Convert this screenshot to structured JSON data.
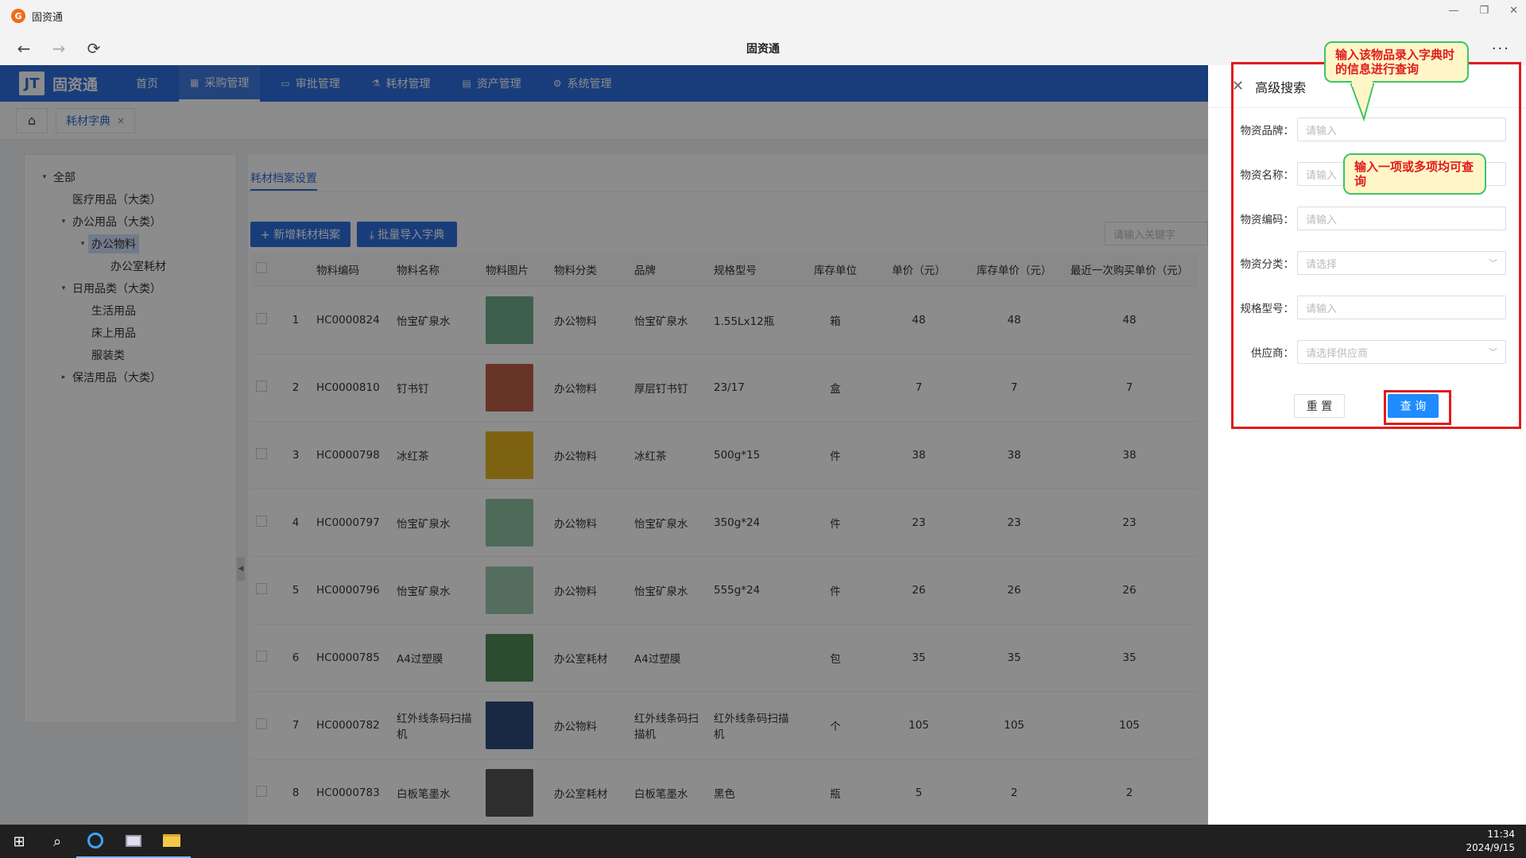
{
  "window": {
    "title": "固资通",
    "app_icon_letter": "G",
    "page_title": "固资通",
    "controls": [
      "—",
      "❐",
      "✕"
    ]
  },
  "browser": {
    "back": "←",
    "forward": "→",
    "refresh": "⟳",
    "more": "···"
  },
  "brand": {
    "logo_mark": "JT",
    "name": "固资通"
  },
  "topnav": [
    {
      "label": "首页",
      "icon": ""
    },
    {
      "label": "采购管理",
      "icon": "grid-icon",
      "active": true
    },
    {
      "label": "审批管理",
      "icon": "monitor-icon"
    },
    {
      "label": "耗材管理",
      "icon": "flask-icon"
    },
    {
      "label": "资产管理",
      "icon": "calendar-icon"
    },
    {
      "label": "系统管理",
      "icon": "gear-icon"
    }
  ],
  "tabs": {
    "home_icon": "⌂",
    "open_tab": "耗材字典",
    "close": "×"
  },
  "tree": [
    {
      "label": "全部",
      "level": 0,
      "toggle": "▾"
    },
    {
      "label": "医疗用品（大类）",
      "level": 1,
      "toggle": ""
    },
    {
      "label": "办公用品（大类）",
      "level": 1,
      "toggle": "▾"
    },
    {
      "label": "办公物料",
      "level": 2,
      "toggle": "▾",
      "selected": true
    },
    {
      "label": "办公室耗材",
      "level": 3,
      "toggle": ""
    },
    {
      "label": "日用品类（大类）",
      "level": 1,
      "toggle": "▾"
    },
    {
      "label": "生活用品",
      "level": 2,
      "toggle": ""
    },
    {
      "label": "床上用品",
      "level": 2,
      "toggle": ""
    },
    {
      "label": "服装类",
      "level": 2,
      "toggle": ""
    },
    {
      "label": "保洁用品（大类）",
      "level": 1,
      "toggle": "▸"
    }
  ],
  "main": {
    "subtab": "耗材档案设置",
    "add_button": "+ 新增耗材档案",
    "import_button": "⤓ 批量导入字典",
    "keyword_placeholder": "请输入关键字"
  },
  "table": {
    "headers": [
      "物料编码",
      "物料名称",
      "物料图片",
      "物料分类",
      "品牌",
      "规格型号",
      "库存单位",
      "单价（元）",
      "库存单价（元）",
      "最近一次购买单价（元）"
    ],
    "rows": [
      {
        "idx": "1",
        "code": "HC0000824",
        "name": "怡宝矿泉水",
        "img": "#6fae8a",
        "cat": "办公物料",
        "brand": "怡宝矿泉水",
        "spec": "1.55Lx12瓶",
        "unit": "箱",
        "price": "48",
        "stock_price": "48",
        "last_price": "48"
      },
      {
        "idx": "2",
        "code": "HC0000810",
        "name": "钉书钉",
        "img": "#c0604a",
        "cat": "办公物料",
        "brand": "厚层钉书钉",
        "spec": "23/17",
        "unit": "盒",
        "price": "7",
        "stock_price": "7",
        "last_price": "7"
      },
      {
        "idx": "3",
        "code": "HC0000798",
        "name": "冰红茶",
        "img": "#e3b21f",
        "cat": "办公物料",
        "brand": "冰红茶",
        "spec": "500g*15",
        "unit": "件",
        "price": "38",
        "stock_price": "38",
        "last_price": "38"
      },
      {
        "idx": "4",
        "code": "HC0000797",
        "name": "怡宝矿泉水",
        "img": "#8fc4a4",
        "cat": "办公物料",
        "brand": "怡宝矿泉水",
        "spec": "350g*24",
        "unit": "件",
        "price": "23",
        "stock_price": "23",
        "last_price": "23"
      },
      {
        "idx": "5",
        "code": "HC0000796",
        "name": "怡宝矿泉水",
        "img": "#9cc9ad",
        "cat": "办公物料",
        "brand": "怡宝矿泉水",
        "spec": "555g*24",
        "unit": "件",
        "price": "26",
        "stock_price": "26",
        "last_price": "26"
      },
      {
        "idx": "6",
        "code": "HC0000785",
        "name": "A4过塑膜",
        "img": "#4f8a55",
        "cat": "办公室耗材",
        "brand": "A4过塑膜",
        "spec": "",
        "unit": "包",
        "price": "35",
        "stock_price": "35",
        "last_price": "35"
      },
      {
        "idx": "7",
        "code": "HC0000782",
        "name": "红外线条码扫描机",
        "img": "#2f4a7a",
        "cat": "办公物料",
        "brand": "红外线条码扫描机",
        "spec": "红外线条码扫描机",
        "unit": "个",
        "price": "105",
        "stock_price": "105",
        "last_price": "105"
      },
      {
        "idx": "8",
        "code": "HC0000783",
        "name": "白板笔墨水",
        "img": "#555555",
        "cat": "办公室耗材",
        "brand": "白板笔墨水",
        "spec": "黑色",
        "unit": "瓶",
        "price": "5",
        "stock_price": "2",
        "last_price": "2"
      }
    ]
  },
  "drawer": {
    "close": "✕",
    "title": "高级搜索",
    "fields": [
      {
        "label": "物资品牌：",
        "placeholder": "请输入",
        "select": false
      },
      {
        "label": "物资名称：",
        "placeholder": "请输入",
        "select": false
      },
      {
        "label": "物资编码：",
        "placeholder": "请输入",
        "select": false
      },
      {
        "label": "物资分类：",
        "placeholder": "请选择",
        "select": true
      },
      {
        "label": "规格型号：",
        "placeholder": "请输入",
        "select": false
      },
      {
        "label": "供应商：",
        "placeholder": "请选择供应商",
        "select": true
      }
    ],
    "chevron": "﹀",
    "reset": "重 置",
    "search": "查 询"
  },
  "callouts": {
    "top": "输入该物品录入字典时的信息进行查询",
    "middle": "输入一项或多项均可查询"
  },
  "taskbar": {
    "start": "⊞",
    "search": "⌕",
    "time": "11:34",
    "date": "2024/9/15"
  },
  "colors": {
    "primary": "#2f6fe0",
    "callout_text": "#e01c1c",
    "callout_border": "#3cc46a",
    "callout_bg": "#fff6c8"
  }
}
